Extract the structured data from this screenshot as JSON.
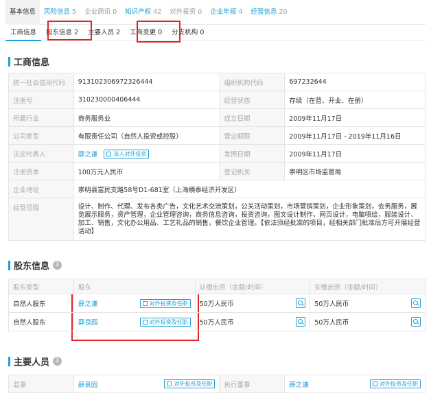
{
  "top_tabs": [
    {
      "label": "基本信息",
      "count": "",
      "style": "active"
    },
    {
      "label": "风险信息",
      "count": "5",
      "style": "blue"
    },
    {
      "label": "企业简讯",
      "count": "0",
      "style": "gray"
    },
    {
      "label": "知识产权",
      "count": "42",
      "style": "blue"
    },
    {
      "label": "对外投资",
      "count": "0",
      "style": "gray"
    },
    {
      "label": "企业年报",
      "count": "4",
      "style": "blue"
    },
    {
      "label": "经营信息",
      "count": "20",
      "style": "blue"
    }
  ],
  "sub_tabs": [
    {
      "label": "工商信息",
      "count": ""
    },
    {
      "label": "股东信息",
      "count": "2"
    },
    {
      "label": "主要人员",
      "count": "2"
    },
    {
      "label": "工商变更",
      "count": "0"
    },
    {
      "label": "分支机构",
      "count": "0"
    }
  ],
  "business_info": {
    "title": "工商信息",
    "credit_code_label": "统一社会信用代码",
    "credit_code": "913102306972326444",
    "org_code_label": "组织机构代码",
    "org_code": "697232644",
    "reg_no_label": "注册号",
    "reg_no": "310230000406444",
    "status_label": "经营状态",
    "status": "存续（在营、开业、在册）",
    "industry_label": "所属行业",
    "industry": "商务服务业",
    "founded_label": "成立日期",
    "founded": "2009年11月17日",
    "type_label": "公司类型",
    "type": "有限责任公司（自然人投资或控股）",
    "term_label": "营业期限",
    "term": "2009年11月17日 - 2019年11月16日",
    "legal_rep_label": "法定代表人",
    "legal_rep": "薛之谦",
    "legal_rep_button": "法人对外投资",
    "issue_date_label": "发照日期",
    "issue_date": "2009年11月17日",
    "capital_label": "注册资本",
    "capital": "100万元人民币",
    "authority_label": "登记机关",
    "authority": "崇明区市场监管局",
    "address_label": "企业地址",
    "address": "崇明县富民支路58号D1-681室（上海横泰经济开发区）",
    "scope_label": "经营范围",
    "scope": "设计、制作、代理、发布各类广告，文化艺术交流策划，公关活动策划，市场营销策划，企业形象策划，会务服务，展览展示服务，资产管理，企业管理咨询，商务信息咨询，投资咨询，图文设计制作，网页设计，电脑喷绘，服装设计、加工、销售，文化办公用品、工艺礼品的销售，餐饮企业管理。【依法须经批准的项目，经相关部门批准后方可开展经营活动】"
  },
  "shareholders": {
    "title": "股东信息",
    "count": "2",
    "headers": [
      "股东类型",
      "股东",
      "认缴出资（金额/时间）",
      "实缴出资（金额/时间）"
    ],
    "button_label": "对外投资及任职",
    "rows": [
      {
        "type": "自然人股东",
        "name": "薛之谦",
        "subscribed": "50万人民币",
        "paid": "50万人民币"
      },
      {
        "type": "自然人股东",
        "name": "薛良园",
        "subscribed": "50万人民币",
        "paid": "50万人民币"
      }
    ]
  },
  "key_personnel": {
    "title": "主要人员",
    "count": "2",
    "button_label": "对外投资及任职",
    "rows": [
      {
        "role1": "监事",
        "name1": "薛良园",
        "role2": "执行董事",
        "name2": "薛之谦"
      }
    ]
  },
  "colors": {
    "accent": "#1a9fd6",
    "highlight_box": "#e02424",
    "label_bg": "#f7f7f7"
  }
}
